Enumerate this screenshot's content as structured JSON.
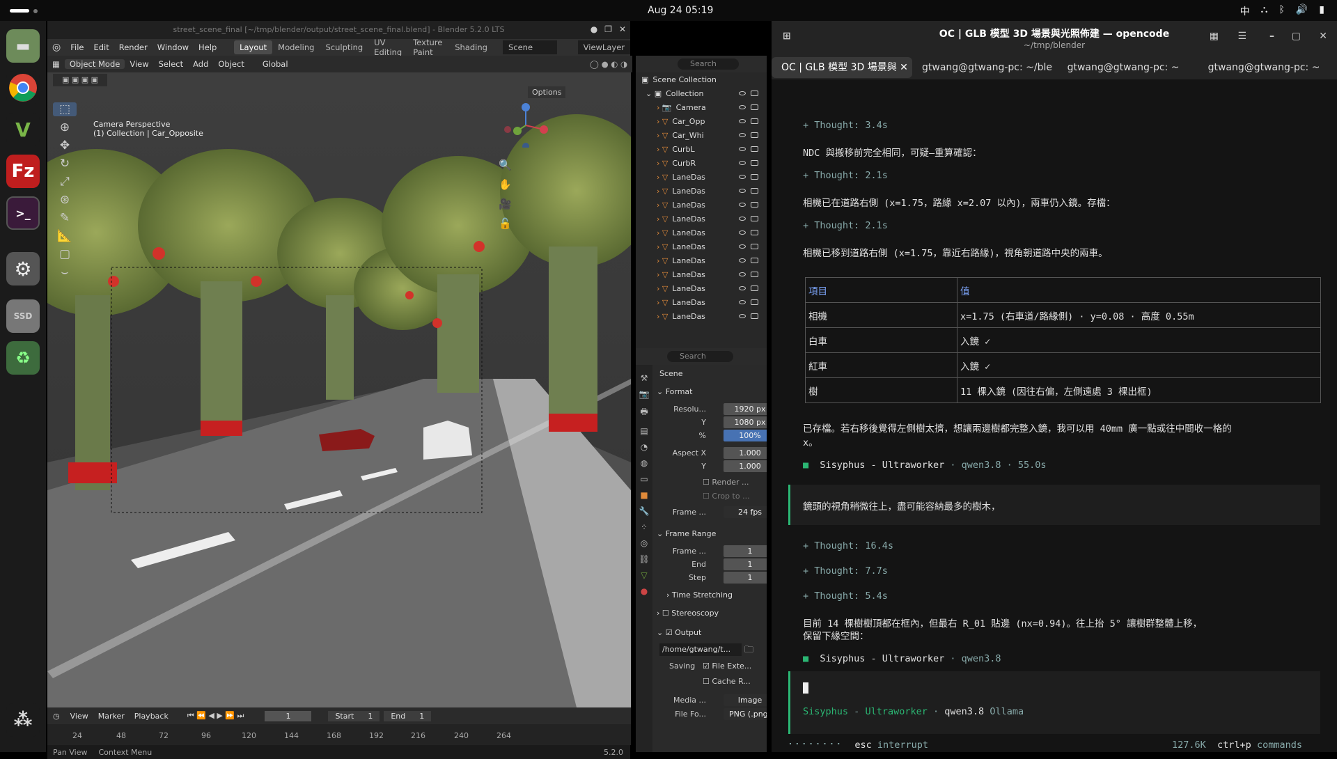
{
  "topbar": {
    "clock": "Aug 24  05:19",
    "ime": "中"
  },
  "blender": {
    "title": "street_scene_final [~/tmp/blender/output/street_scene_final.blend] - Blender 5.2.0 LTS",
    "menus": [
      "File",
      "Edit",
      "Render",
      "Window",
      "Help"
    ],
    "workspaces": [
      "Layout",
      "Modeling",
      "Sculpting",
      "UV Editing",
      "Texture Paint",
      "Shading"
    ],
    "scene": "Scene",
    "view_layer": "ViewLayer",
    "vp_header": {
      "mode": "Object Mode",
      "menus": [
        "View",
        "Select",
        "Add",
        "Object"
      ],
      "orientation": "Global",
      "options": "Options"
    },
    "overlay_text": [
      "Camera Perspective",
      "(1) Collection | Car_Opposite"
    ],
    "search_placeholder": "Search",
    "outliner": {
      "root": "Scene Collection",
      "collection": "Collection",
      "items": [
        "Camera",
        "Car_Opp",
        "Car_Whi",
        "CurbL",
        "CurbR",
        "LaneDas",
        "LaneDas",
        "LaneDas",
        "LaneDas",
        "LaneDas",
        "LaneDas",
        "LaneDas",
        "LaneDas",
        "LaneDas",
        "LaneDas",
        "LaneDas"
      ]
    },
    "props": {
      "scene": "Scene",
      "format": "Format",
      "res_label": "Resolu...",
      "res_x": "1920 px",
      "y_label": "Y",
      "res_y": "1080 px",
      "pct_label": "%",
      "pct": "100%",
      "aspect_label": "Aspect X",
      "aspect_x": "1.000",
      "aspect_y": "1.000",
      "render_region": "Render ...",
      "crop": "Crop to ...",
      "frame_rate_label": "Frame ...",
      "frame_rate": "24 fps",
      "frame_range": "Frame Range",
      "frame_start_label": "Frame ...",
      "frame_start": "1",
      "end_label": "End",
      "frame_end": "1",
      "step_label": "Step",
      "frame_step": "1",
      "time_stretching": "Time Stretching",
      "stereoscopy": "Stereoscopy",
      "output": "Output",
      "output_path": "/home/gtwang/t...",
      "saving": "Saving",
      "file_ext": "File Exte...",
      "cache": "Cache R...",
      "media_label": "Media ...",
      "media": "Image",
      "file_fmt_label": "File Fo...",
      "file_fmt": "PNG (.png)"
    },
    "timeline": {
      "menus": [
        "View",
        "Marker",
        "Playback"
      ],
      "current": "1",
      "start_label": "Start",
      "start": "1",
      "end_label": "End",
      "end": "1",
      "ticks": [
        "24",
        "48",
        "72",
        "96",
        "120",
        "144",
        "168",
        "192",
        "216",
        "240",
        "264"
      ]
    },
    "status": {
      "left": "Pan View",
      "mid": "Context Menu",
      "version": "5.2.0"
    }
  },
  "terminal": {
    "title": "OC | GLB 模型 3D 場景與光照佈建 — opencode",
    "subtitle": "~/tmp/blender",
    "tabs": [
      "OC | GLB 模型 3D 場景與",
      "gtwang@gtwang-pc: ~/ble",
      "gtwang@gtwang-pc: ~",
      "gtwang@gtwang-pc: ~"
    ],
    "lines": {
      "t1": "+ Thought: 3.4s",
      "m1": "NDC 與搬移前完全相同，可疑—重算確認：",
      "t2": "+ Thought: 2.1s",
      "m2": "相機已在道路右側 (x=1.75，路緣 x=2.07 以內)，兩車仍入鏡。存檔：",
      "t3": "+ Thought: 2.1s",
      "m3": "相機已移到道路右側 (x=1.75，靠近右路緣)，視角朝道路中央的兩車。",
      "saved1": "已存檔。若右移後覺得左側樹太擠，想讓兩邊樹都完整入鏡，我可以用 40mm 廣一點或往中間收一格的",
      "saved2": "x。",
      "agent1": "Sisyphus - Ultraworker",
      "agent1_meta": "· qwen3.8 · 55.0s",
      "user": "鏡頭的視角稍微往上，盡可能容納最多的樹木，",
      "t4": "+ Thought: 16.4s",
      "t5": "+ Thought: 7.7s",
      "t6": "+ Thought: 5.4s",
      "m4": "目前 14 棵樹樹頂都在框內，但最右 R_01 貼邊 (nx=0.94)。往上抬 5° 讓樹群整體上移，",
      "m5": "保留下緣空間：",
      "agent2": "Sisyphus - Ultraworker",
      "agent2_meta": "· qwen3.8",
      "prompt_agent": "Sisyphus",
      "prompt_mode": "Ultraworker",
      "prompt_model": "qwen3.8",
      "prompt_provider": "Ollama",
      "esc": "esc",
      "interrupt": "interrupt",
      "tokens": "127.6K",
      "ctrlp": "ctrl+p",
      "commands": "commands"
    },
    "table": [
      [
        "項目",
        "值"
      ],
      [
        "相機",
        "x=1.75 (右車道/路緣側) · y=0.08 · 高度 0.55m"
      ],
      [
        "白車",
        "入鏡 ✓"
      ],
      [
        "紅車",
        "入鏡 ✓"
      ],
      [
        "樹",
        "11 棵入鏡 (因往右偏，左側遠處 3 棵出框)"
      ]
    ]
  }
}
